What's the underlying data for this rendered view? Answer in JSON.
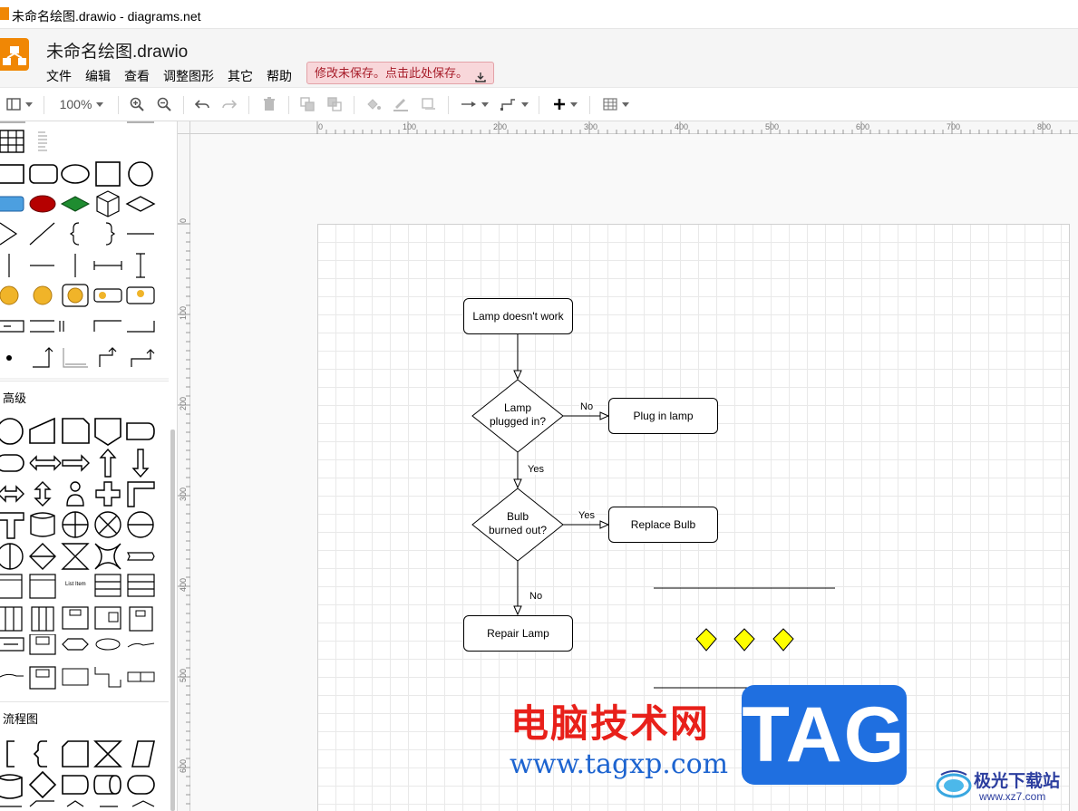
{
  "window": {
    "title": "未命名绘图.drawio - diagrams.net"
  },
  "header": {
    "doc_title": "未命名绘图.drawio",
    "menu": [
      "文件",
      "编辑",
      "查看",
      "调整图形",
      "其它",
      "帮助"
    ],
    "unsaved_notice": "修改未保存。点击此处保存。"
  },
  "toolbar": {
    "zoom": "100%",
    "icons": [
      "format-panel-icon",
      "zoom-in-icon",
      "zoom-out-icon",
      "undo-icon",
      "redo-icon",
      "delete-icon",
      "to-front-icon",
      "to-back-icon",
      "fill-color-icon",
      "line-color-icon",
      "shadow-icon",
      "connection-icon",
      "waypoints-icon",
      "insert-icon",
      "table-icon"
    ]
  },
  "sidebar": {
    "sections": [
      {
        "label": "高级"
      },
      {
        "label": "流程图"
      }
    ],
    "misc_labels": {
      "link": "Link",
      "variable": "Variable Text",
      "list_item": "List Item"
    }
  },
  "ruler": {
    "h_ticks": [
      "0",
      "100",
      "200",
      "300",
      "400",
      "500",
      "600",
      "700",
      "800"
    ],
    "v_ticks": [
      "0",
      "100",
      "200",
      "300",
      "400",
      "500",
      "600"
    ]
  },
  "diagram": {
    "nodes": {
      "start": "Lamp doesn't work",
      "q1": "Lamp\nplugged in?",
      "a1": "Plug in lamp",
      "q2": "Bulb\nburned out?",
      "a2": "Replace Bulb",
      "end": "Repair Lamp"
    },
    "edges": {
      "q1_no": "No",
      "q1_yes": "Yes",
      "q2_yes": "Yes",
      "q2_no": "No"
    },
    "colors": {
      "diamond_fill": "#ffff00",
      "stroke": "#000000"
    }
  },
  "watermark": {
    "cn": "电脑技术网",
    "url": "www.tagxp.com",
    "tag": "TAG",
    "site_cn": "极光下载站",
    "site_url": "www.xz7.com"
  }
}
